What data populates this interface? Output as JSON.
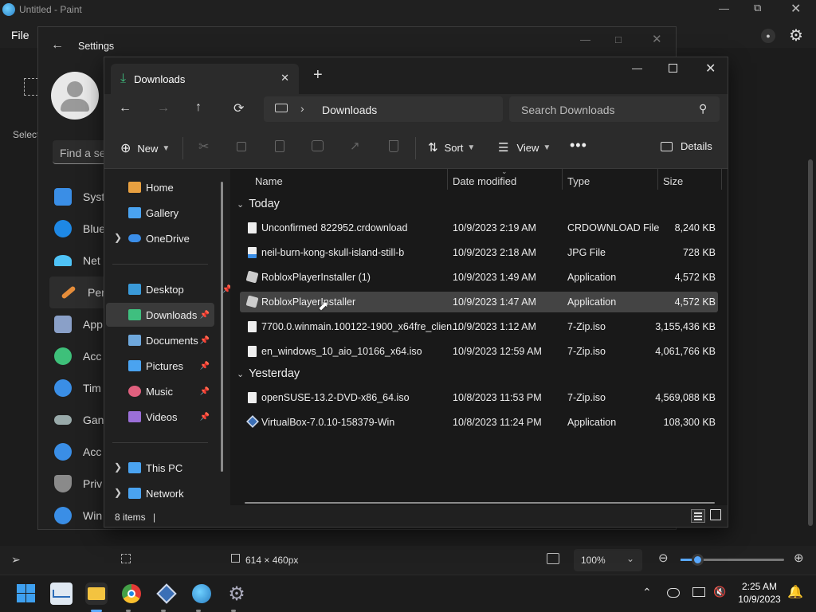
{
  "paint": {
    "title": "Untitled - Paint",
    "menu_file": "File",
    "select_label": "Select",
    "dimensions": "614 × 460px",
    "zoom": "100%"
  },
  "settings": {
    "title": "Settings",
    "search_placeholder": "Find a se",
    "items": [
      {
        "label": "Syst",
        "color": "#3a8ee6"
      },
      {
        "label": "Blue",
        "color": "#1e88e5"
      },
      {
        "label": "Net",
        "color": "#4fc3f7"
      },
      {
        "label": "Pers",
        "color": "#e58d3a"
      },
      {
        "label": "App",
        "color": "#8aa0c8"
      },
      {
        "label": "Acc",
        "color": "#3ec07a"
      },
      {
        "label": "Tim",
        "color": "#3a8ee6"
      },
      {
        "label": "Gan",
        "color": "#9aa"
      },
      {
        "label": "Acc",
        "color": "#3a8ee6"
      },
      {
        "label": "Priv",
        "color": "#8a8a8a"
      },
      {
        "label": "Win",
        "color": "#3a8ee6"
      }
    ]
  },
  "explorer": {
    "tab_title": "Downloads",
    "breadcrumb": "Downloads",
    "search_placeholder": "Search Downloads",
    "cmd": {
      "new": "New",
      "sort": "Sort",
      "view": "View",
      "details": "Details"
    },
    "nav": [
      {
        "label": "Home",
        "color": "#e8a040"
      },
      {
        "label": "Gallery",
        "color": "#4aa3f0"
      },
      {
        "label": "OneDrive",
        "color": "#3b8ee8"
      },
      {
        "label": "Desktop",
        "color": "#3a9ad9"
      },
      {
        "label": "Downloads",
        "color": "#3fbf7f"
      },
      {
        "label": "Documents",
        "color": "#6fa8dc"
      },
      {
        "label": "Pictures",
        "color": "#4aa3f0"
      },
      {
        "label": "Music",
        "color": "#e0607e"
      },
      {
        "label": "Videos",
        "color": "#9b6fd8"
      },
      {
        "label": "This PC",
        "color": "#4aa3f0"
      },
      {
        "label": "Network",
        "color": "#4aa3f0"
      }
    ],
    "columns": {
      "name": "Name",
      "date": "Date modified",
      "type": "Type",
      "size": "Size"
    },
    "groups": [
      {
        "label": "Today",
        "files": [
          {
            "name": "Unconfirmed 822952.crdownload",
            "date": "10/9/2023 2:19 AM",
            "type": "CRDOWNLOAD File",
            "size": "8,240 KB"
          },
          {
            "name": "neil-burn-kong-skull-island-still-b",
            "date": "10/9/2023 2:18 AM",
            "type": "JPG File",
            "size": "728 KB"
          },
          {
            "name": "RobloxPlayerInstaller (1)",
            "date": "10/9/2023 1:49 AM",
            "type": "Application",
            "size": "4,572 KB"
          },
          {
            "name": "RobloxPlayerInstaller",
            "date": "10/9/2023 1:47 AM",
            "type": "Application",
            "size": "4,572 KB"
          },
          {
            "name": "7700.0.winmain.100122-1900_x64fre_clien...",
            "date": "10/9/2023 1:12 AM",
            "type": "7-Zip.iso",
            "size": "3,155,436 KB"
          },
          {
            "name": "en_windows_10_aio_10166_x64.iso",
            "date": "10/9/2023 12:59 AM",
            "type": "7-Zip.iso",
            "size": "4,061,766 KB"
          }
        ]
      },
      {
        "label": "Yesterday",
        "files": [
          {
            "name": "openSUSE-13.2-DVD-x86_64.iso",
            "date": "10/8/2023 11:53 PM",
            "type": "7-Zip.iso",
            "size": "4,569,088 KB"
          },
          {
            "name": "VirtualBox-7.0.10-158379-Win",
            "date": "10/8/2023 11:24 PM",
            "type": "Application",
            "size": "108,300 KB"
          }
        ]
      }
    ],
    "item_count": "8 items"
  },
  "taskbar": {
    "time": "2:25 AM",
    "date": "10/9/2023"
  },
  "colors": {
    "accent": "#3a8ee6",
    "selection": "#444444"
  }
}
